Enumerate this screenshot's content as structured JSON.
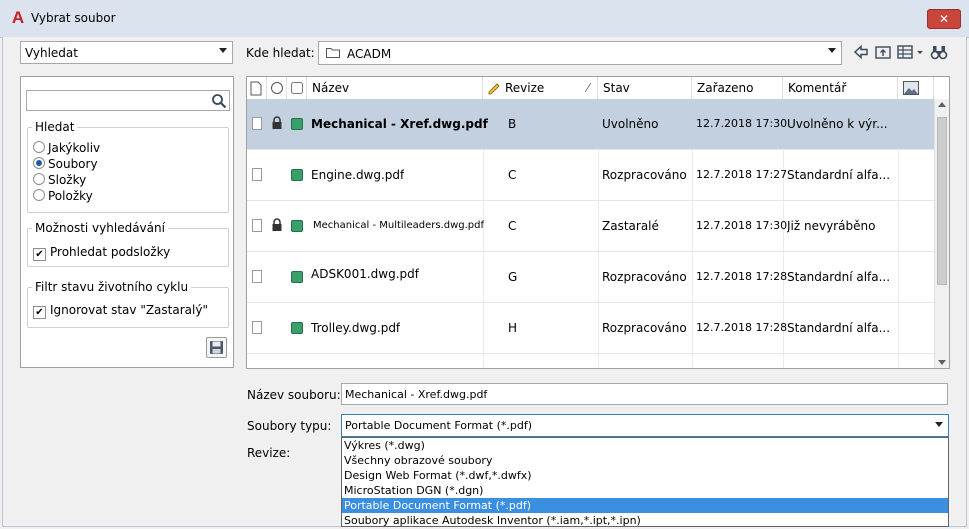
{
  "window": {
    "title": "Vybrat soubor",
    "app_icon": "A",
    "close_label": "✕"
  },
  "left": {
    "search_mode": "Vyhledat",
    "search_placeholder": "",
    "lookfor": {
      "title": "Hledat",
      "options": [
        "Jakýkoliv",
        "Soubory",
        "Složky",
        "Položky"
      ],
      "selected": "Soubory"
    },
    "search_options": {
      "title": "Možnosti vyhledávání",
      "subfolders_label": "Prohledat podsložky",
      "subfolders_checked": true
    },
    "lifecycle_filter": {
      "title": "Filtr stavu životního cyklu",
      "ignore_label": "Ignorovat stav \"Zastaralý\"",
      "ignore_checked": true
    }
  },
  "location": {
    "label": "Kde hledat:",
    "path": "ACADM"
  },
  "list": {
    "columns": [
      "Název",
      "Revize",
      "Stav",
      "Zařazeno",
      "Komentář"
    ],
    "rows": [
      {
        "name": "Mechanical - Xref.dwg.pdf",
        "revision": "B",
        "state": "Uvolněno",
        "date": "12.7.2018 17:30",
        "comment": "Uvolněno k výr...",
        "locked": true,
        "selected": true
      },
      {
        "name": "Engine.dwg.pdf",
        "revision": "C",
        "state": "Rozpracováno",
        "date": "12.7.2018 17:27",
        "comment": "Standardní alfa...",
        "locked": false,
        "selected": false
      },
      {
        "name": "Mechanical - Multileaders.dwg.pdf",
        "revision": "C",
        "state": "Zastaralé",
        "date": "12.7.2018 17:30",
        "comment": "Již nevyráběno",
        "locked": true,
        "selected": false
      },
      {
        "name": "ADSK001.dwg.pdf",
        "revision": "G",
        "state": "Rozpracováno",
        "date": "12.7.2018 17:28",
        "comment": "Standardní alfa...",
        "locked": false,
        "selected": false
      },
      {
        "name": "Trolley.dwg.pdf",
        "revision": "H",
        "state": "Rozpracováno",
        "date": "12.7.2018 17:28",
        "comment": "Standardní alfa...",
        "locked": false,
        "selected": false
      }
    ]
  },
  "filename": {
    "label": "Název souboru:",
    "value": "Mechanical - Xref.dwg.pdf"
  },
  "filetype": {
    "label": "Soubory typu:",
    "selected": "Portable Document Format (*.pdf)",
    "options": [
      "Výkres (*.dwg)",
      "Všechny obrazové soubory",
      "Design Web Format (*.dwf,*.dwfx)",
      "MicroStation DGN (*.dgn)",
      "Portable Document Format (*.pdf)",
      "Soubory aplikace Autodesk Inventor (*.iam,*.ipt,*.ipn)"
    ]
  },
  "revision_label": "Revize:",
  "colors": {
    "selected_row": "#c2d0e0",
    "dropdown_highlight": "#3b8fe0",
    "state_green": "#3aa06a",
    "close_red": "#c8463c"
  }
}
